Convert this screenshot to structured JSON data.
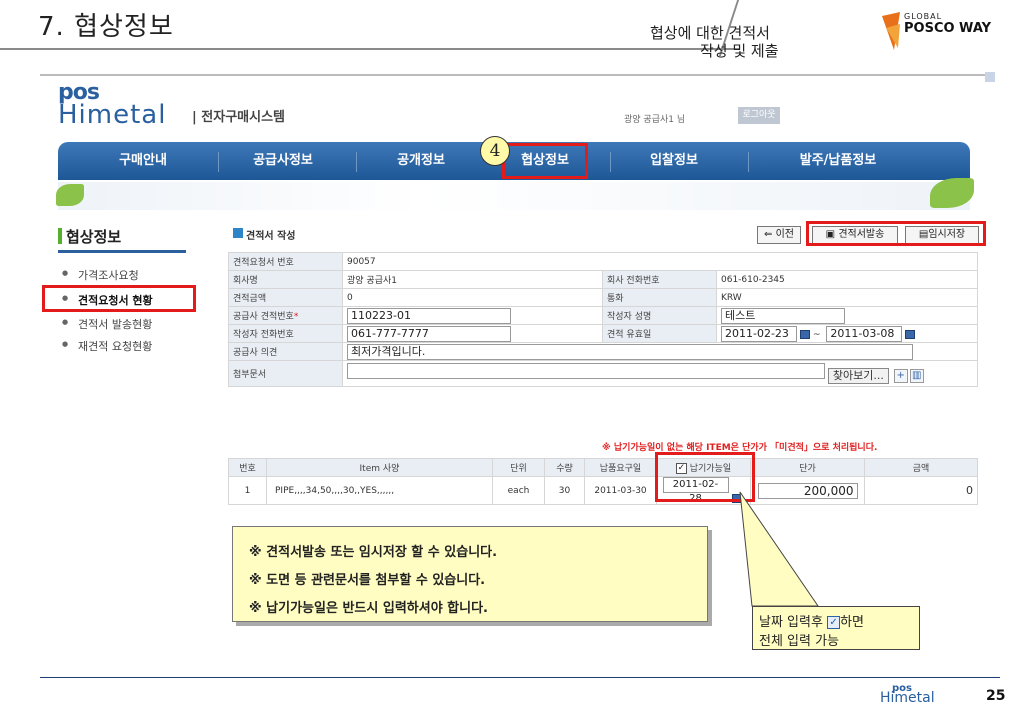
{
  "slide": {
    "title": "7. 협상정보",
    "subtitle_line1": "협상에 대한 견적서",
    "subtitle_line2": "작성 및 제출",
    "brand_small": "GLOBAL",
    "brand_main": "POSCO WAY",
    "page_number": "25"
  },
  "app": {
    "logo_top": "pos",
    "logo_bottom": "Himetal",
    "system_title": "| 전자구매시스템",
    "user_greeting": "광양 공급사1 님",
    "logout_label": "로그아웃"
  },
  "nav": {
    "items": [
      "구매안내",
      "공급사정보",
      "공개정보",
      "협상정보",
      "입찰정보",
      "발주/납품정보"
    ],
    "active": "협상정보",
    "step_badge": "4"
  },
  "sidebar": {
    "title": "협상정보",
    "items": [
      "가격조사요청",
      "견적요청서 현황",
      "견적서 발송현황",
      "재견적 요청현황"
    ],
    "active": "견적요청서 현황"
  },
  "toolbar": {
    "section_title": "견적서 작성",
    "back_label": "⇐ 이전",
    "send_label": "견적서발송",
    "save_label": "임시저장"
  },
  "form": {
    "rfq_no_label": "견적요청서 번호",
    "rfq_no": "90057",
    "company_label": "회사명",
    "company": "광양 공급사1",
    "phone_label": "회사 전화번호",
    "phone": "061-610-2345",
    "amount_label": "견적금액",
    "amount": "0",
    "currency_label": "통화",
    "currency": "KRW",
    "quote_no_label": "공급사 견적번호",
    "quote_no": "110223-01",
    "author_label": "작성자 성명",
    "author": "테스트",
    "author_phone_label": "작성자 전화번호",
    "author_phone": "061-777-7777",
    "validity_label": "견적 유효일",
    "validity_from": "2011-02-23",
    "validity_to": "2011-03-08",
    "opinion_label": "공급사 의견",
    "opinion": "최저가격입니다.",
    "attach_label": "첨부문서",
    "browse_label": "찾아보기..."
  },
  "notice": "※ 납기가능일이 없는 해당 ITEM은 단가가 「미견적」으로 처리됩니다.",
  "items_table": {
    "headers": [
      "번호",
      "Item 사양",
      "단위",
      "수량",
      "납품요구일",
      "납기가능일",
      "단가",
      "금액"
    ],
    "rows": [
      {
        "no": "1",
        "spec": "PIPE,,,,34,50,,,,30,,YES,,,,,,",
        "unit": "each",
        "qty": "30",
        "due": "2011-03-30",
        "available": "2011-02-28",
        "price": "200,000",
        "amount": "0"
      }
    ]
  },
  "callout": {
    "line1": "※ 견적서발송 또는 임시저장 할 수 있습니다.",
    "line2": "※ 도면 등 관련문서를 첨부할 수 있습니다.",
    "line3": "※ 납기가능일은 반드시 입력하셔야 합니다."
  },
  "tip": {
    "line1_a": "날짜 입력후",
    "line1_b": "하면",
    "line2": "전체 입력 가능"
  },
  "colors": {
    "highlight": "#e31b1b",
    "nav": "#1e5796",
    "callout_bg": "#fffdc2"
  }
}
